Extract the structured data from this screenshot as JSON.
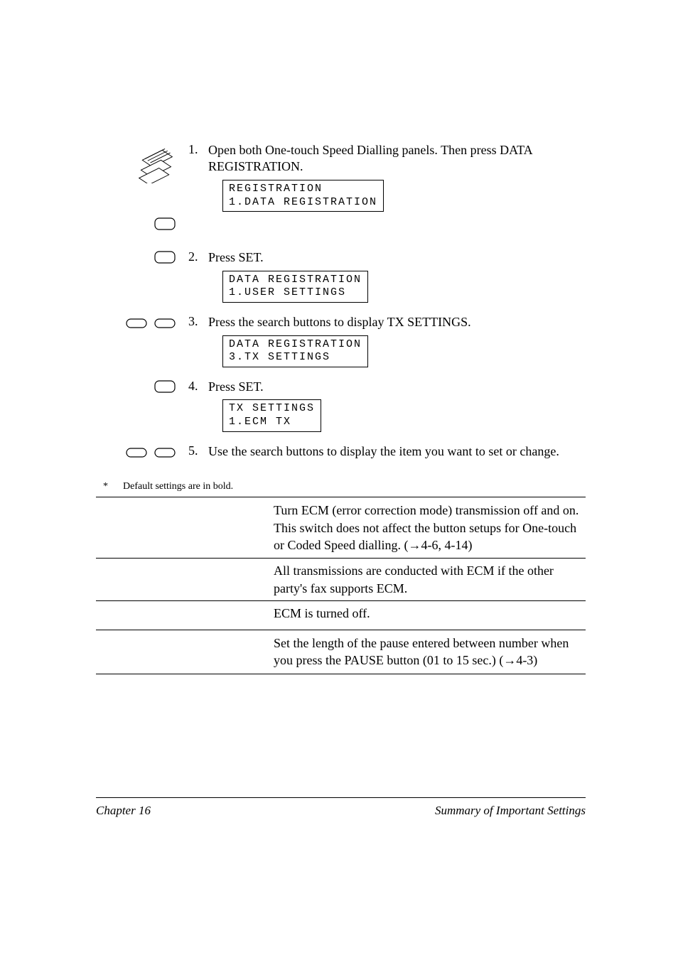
{
  "steps": [
    {
      "num": "1.",
      "text": "Open both One-touch Speed Dialling panels. Then press DATA REGISTRATION.",
      "lcd": "REGISTRATION\n1.DATA REGISTRATION"
    },
    {
      "num": "2.",
      "text": "Press SET.",
      "lcd": "DATA REGISTRATION\n1.USER SETTINGS"
    },
    {
      "num": "3.",
      "text": "Press the search buttons to display TX SETTINGS.",
      "lcd": "DATA REGISTRATION\n3.TX SETTINGS"
    },
    {
      "num": "4.",
      "text": "Press SET.",
      "lcd": "TX SETTINGS\n1.ECM TX"
    },
    {
      "num": "5.",
      "text": "Use the search buttons to display the item you want to set or change.",
      "lcd": ""
    }
  ],
  "footnote_marker": "*",
  "footnote_text": "Default settings are in bold.",
  "table": [
    {
      "desc": "Turn ECM (error correction mode) transmission off and on. This switch does not affect the button setups for One-touch or Coded Speed dialling. (→4-6, 4-14)",
      "sub": [
        {
          "desc": "All transmissions are conducted with ECM if the other party's fax supports ECM."
        },
        {
          "desc": "ECM is turned off."
        }
      ]
    },
    {
      "desc": "Set the length of the pause entered between number when you press the PAUSE button (01 to 15 sec.) (→4-3)"
    }
  ],
  "footer": {
    "left": "Chapter 16",
    "right": "Summary of Important Settings"
  }
}
